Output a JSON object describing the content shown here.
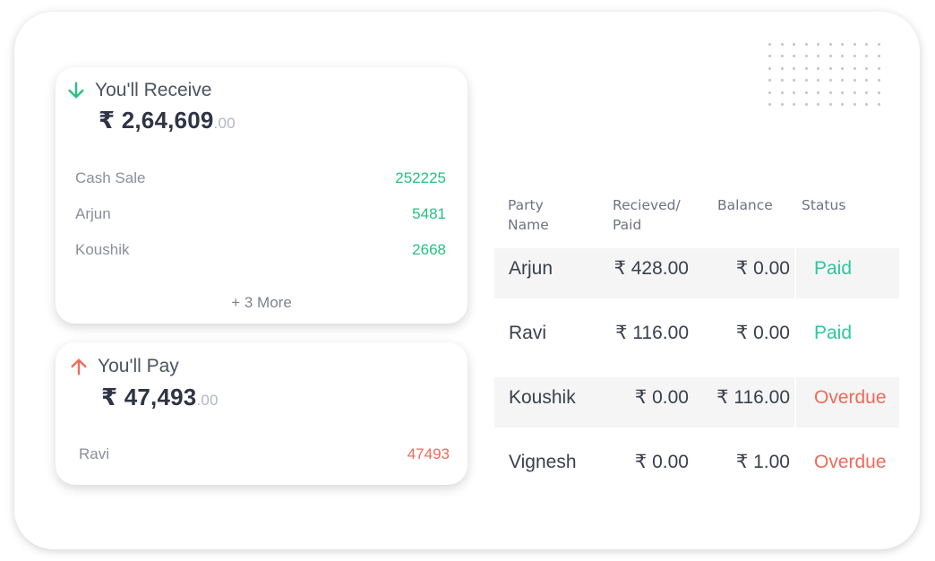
{
  "receive_card": {
    "title": "You'll Receive",
    "icon": "arrow-down-icon",
    "amount_main": "₹ 2,64,609",
    "amount_decimals": ".00",
    "entries": [
      {
        "name": "Cash Sale",
        "value": "252225"
      },
      {
        "name": "Arjun",
        "value": "5481"
      },
      {
        "name": "Koushik",
        "value": "2668"
      }
    ],
    "more_label": "+ 3 More"
  },
  "pay_card": {
    "title": "You'll Pay",
    "icon": "arrow-up-icon",
    "amount_main": "₹ 47,493",
    "amount_decimals": ".00",
    "entries": [
      {
        "name": "Ravi",
        "value": "47493"
      }
    ]
  },
  "table": {
    "headers": {
      "party_line1": "Party",
      "party_line2": "Name",
      "received_line1": "Recieved/",
      "received_line2": "Paid",
      "balance": "Balance",
      "status": "Status"
    },
    "rows": [
      {
        "party": "Arjun",
        "received": "₹ 428.00",
        "balance": "₹ 0.00",
        "status": "Paid"
      },
      {
        "party": "Ravi",
        "received": "₹ 116.00",
        "balance": "₹ 0.00",
        "status": "Paid"
      },
      {
        "party": "Koushik",
        "received": "₹ 0.00",
        "balance": "₹ 116.00",
        "status": "Overdue"
      },
      {
        "party": "Vignesh",
        "received": "₹ 0.00",
        "balance": "₹ 1.00",
        "status": "Overdue"
      }
    ]
  },
  "colors": {
    "receive_accent": "#27c181",
    "pay_accent": "#f06a5a",
    "paid_status": "#2cc7a0",
    "overdue_status": "#f06a5a"
  }
}
